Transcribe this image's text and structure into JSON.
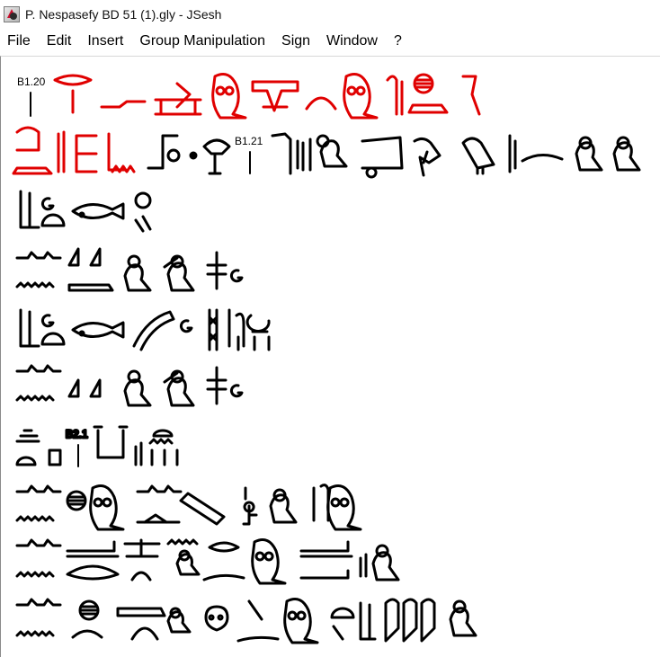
{
  "window": {
    "title": "P. Nespasefy BD 51 (1).gly - JSesh",
    "icon": "jsesh-app-icon"
  },
  "menu": {
    "items": [
      "File",
      "Edit",
      "Insert",
      "Group Manipulation",
      "Sign",
      "Window",
      "?"
    ]
  },
  "document": {
    "line_refs": [
      "B1.20",
      "B1.21",
      "B2.1"
    ]
  },
  "colors": {
    "rubric": "#e00000",
    "ink": "#000000",
    "background": "#ffffff"
  }
}
